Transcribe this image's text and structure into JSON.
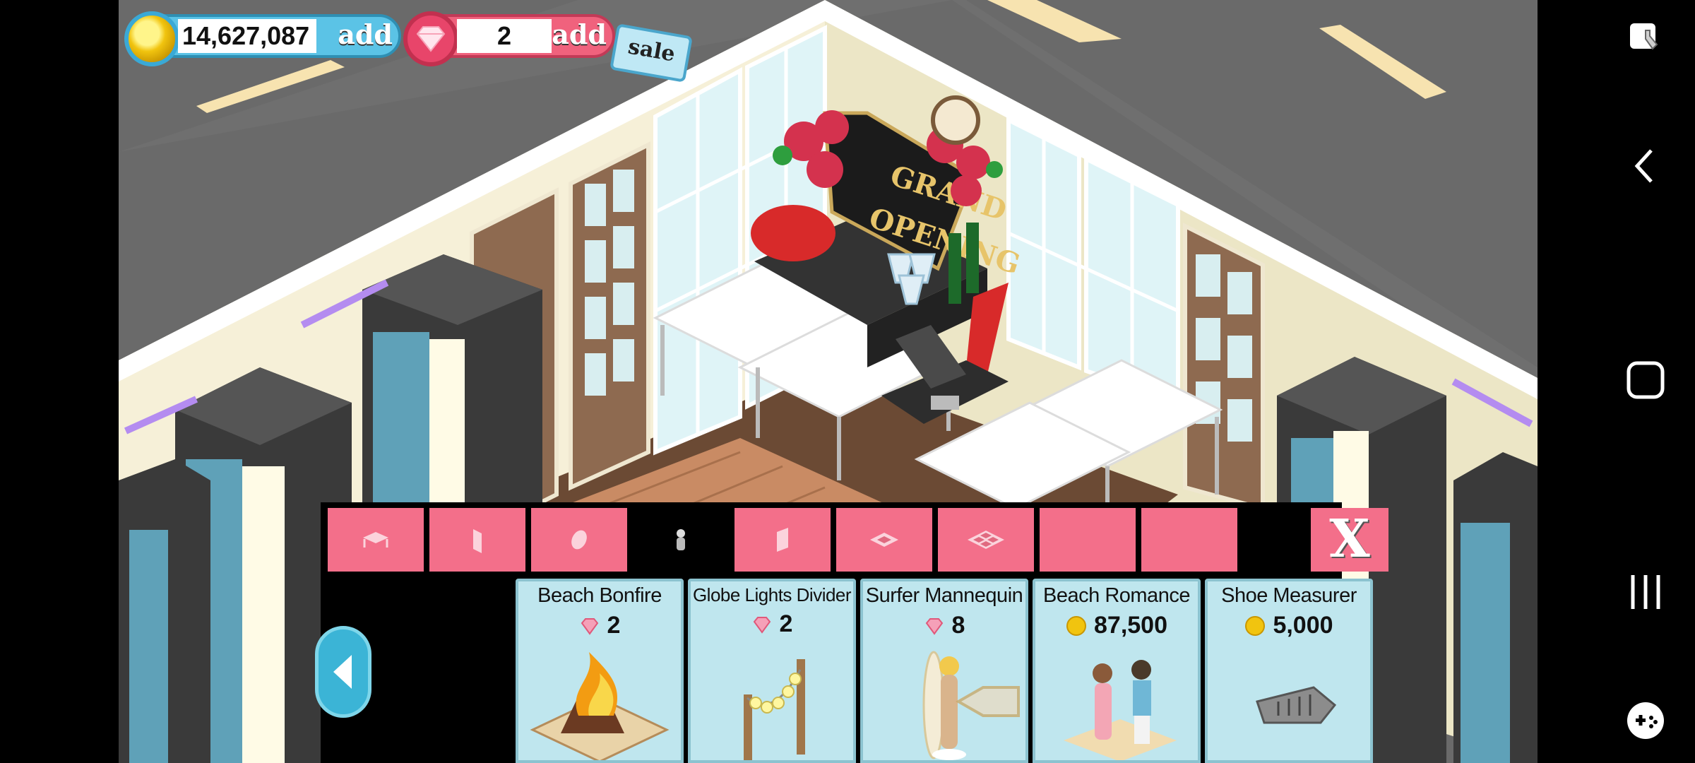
{
  "hud": {
    "coins": "14,627,087",
    "coins_add": "add",
    "gems": "2",
    "gems_add": "add",
    "sale": "sale"
  },
  "scene": {
    "sign_line1": "GRAND",
    "sign_line2": "OPENING"
  },
  "shop": {
    "tabs": [
      {
        "icon": "table-icon"
      },
      {
        "icon": "door-icon"
      },
      {
        "icon": "clock-icon"
      },
      {
        "icon": "mannequin-icon",
        "active": true
      },
      {
        "icon": "wall-icon"
      },
      {
        "icon": "floor-tile-icon"
      },
      {
        "icon": "floor-pattern-icon"
      },
      {
        "icon": "blank"
      },
      {
        "icon": "blank"
      }
    ],
    "close_label": "X",
    "items": [
      {
        "name": "Beach Bonfire",
        "currency": "gem",
        "price": "2"
      },
      {
        "name": "Globe Lights Divider",
        "currency": "gem",
        "price": "2"
      },
      {
        "name": "Surfer Mannequin",
        "currency": "gem",
        "price": "8"
      },
      {
        "name": "Beach Romance",
        "currency": "coin",
        "price": "87,500"
      },
      {
        "name": "Shoe Measurer",
        "currency": "coin",
        "price": "5,000"
      }
    ]
  },
  "colors": {
    "tab_pink": "#f36f8a",
    "card_blue": "#bfe6ee",
    "coin_pill": "#5bc3e6",
    "gem_pill": "#f0627d"
  },
  "system_nav": [
    "gallery-icon",
    "back-icon",
    "home-icon",
    "recents-icon",
    "game-tools-icon"
  ]
}
